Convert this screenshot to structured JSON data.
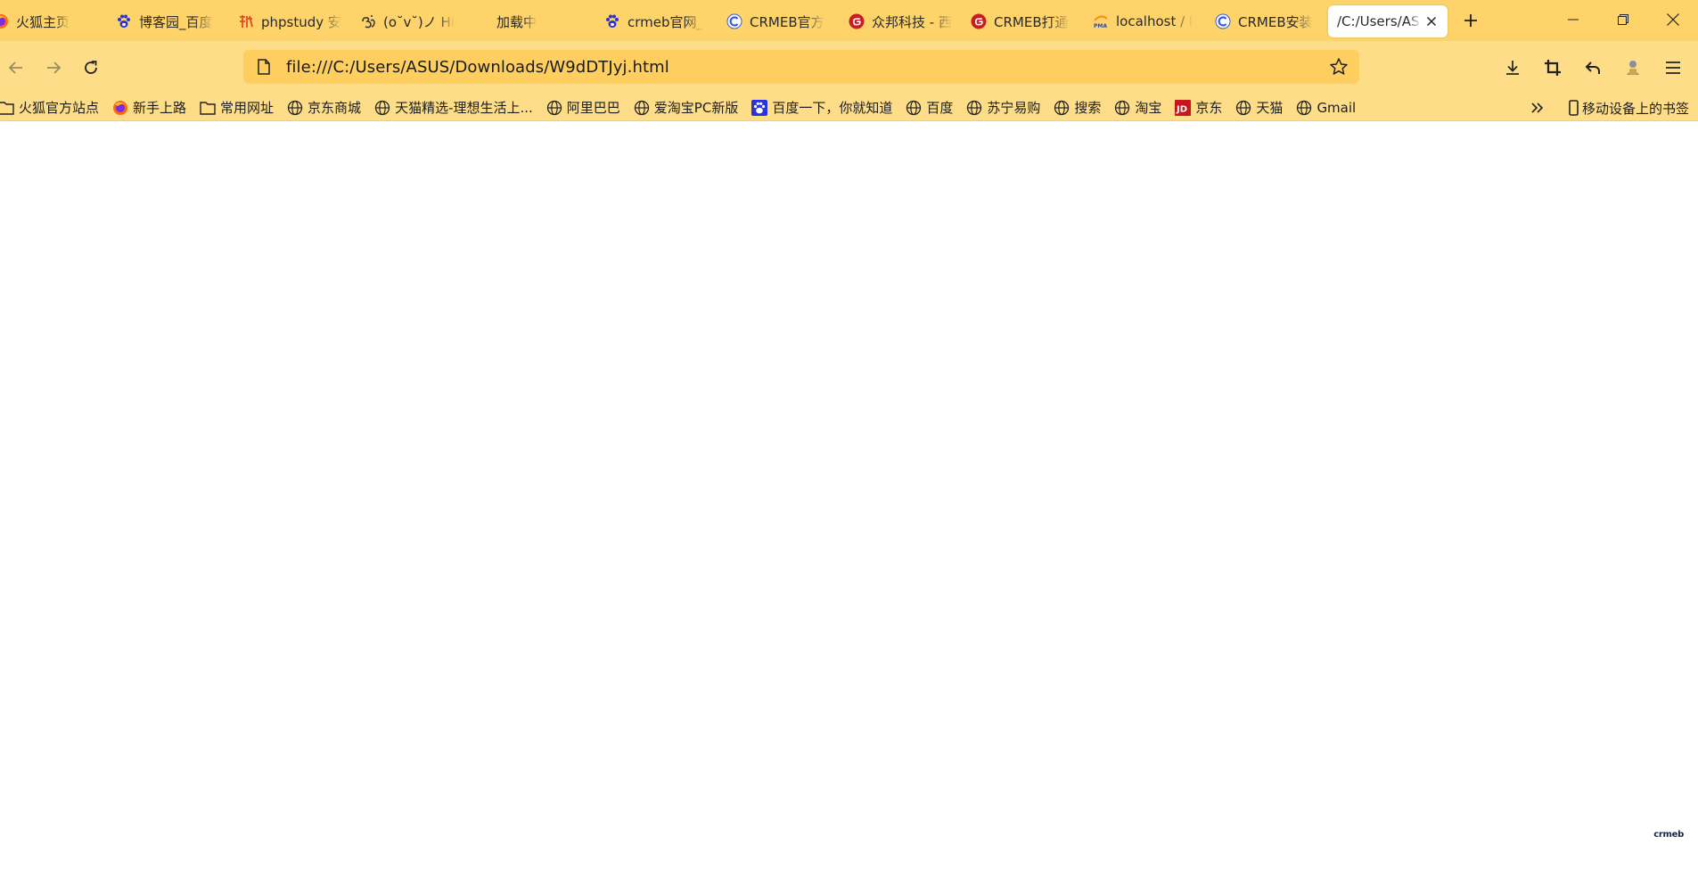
{
  "tabs": [
    {
      "label": "火狐主页",
      "icon": "firefox-icon"
    },
    {
      "label": "博客园_百度",
      "icon": "baidu-paw-icon"
    },
    {
      "label": "phpstudy 安",
      "icon": "phpstudy-icon"
    },
    {
      "label": "(o˘v˘)ノ Hi",
      "icon": "om-icon"
    },
    {
      "label": "加载中",
      "icon": ""
    },
    {
      "label": "crmeb官网_",
      "icon": "baidu-paw-icon"
    },
    {
      "label": "CRMEB官方",
      "icon": "crmeb-c-icon"
    },
    {
      "label": "众邦科技 - 西",
      "icon": "gitee-icon"
    },
    {
      "label": "CRMEB打通",
      "icon": "gitee-icon"
    },
    {
      "label": "localhost / l",
      "icon": "phpmyadmin-icon"
    },
    {
      "label": "CRMEB安装",
      "icon": "crmeb-c-icon"
    },
    {
      "label": "/C:/Users/ASUS",
      "icon": "",
      "active": true
    }
  ],
  "url": "file:///C:/Users/ASUS/Downloads/W9dDTJyj.html",
  "bookmarks": [
    {
      "label": "火狐官方站点",
      "icon": "folder-icon"
    },
    {
      "label": "新手上路",
      "icon": "firefox-icon"
    },
    {
      "label": "常用网址",
      "icon": "folder-icon"
    },
    {
      "label": "京东商城",
      "icon": "globe-icon"
    },
    {
      "label": "天猫精选-理想生活上...",
      "icon": "globe-icon"
    },
    {
      "label": "阿里巴巴",
      "icon": "globe-icon"
    },
    {
      "label": "爱淘宝PC新版",
      "icon": "globe-icon"
    },
    {
      "label": "百度一下，你就知道",
      "icon": "baidu-paw-icon"
    },
    {
      "label": "百度",
      "icon": "globe-icon"
    },
    {
      "label": "苏宁易购",
      "icon": "globe-icon"
    },
    {
      "label": "搜索",
      "icon": "globe-icon"
    },
    {
      "label": "淘宝",
      "icon": "globe-icon"
    },
    {
      "label": "京东",
      "icon": "jd-icon"
    },
    {
      "label": "天猫",
      "icon": "globe-icon"
    },
    {
      "label": "Gmail",
      "icon": "globe-icon"
    }
  ],
  "mobile_bookmarks": "移动设备上的书签",
  "corner_logo": "crmeb",
  "jd_badge": "JD",
  "pma_badge": "PMA",
  "colors": {
    "tabstrip": "#fdd36a",
    "navbar": "#fddd88",
    "urlbar": "#fecf5f",
    "content": "#ffffff"
  }
}
